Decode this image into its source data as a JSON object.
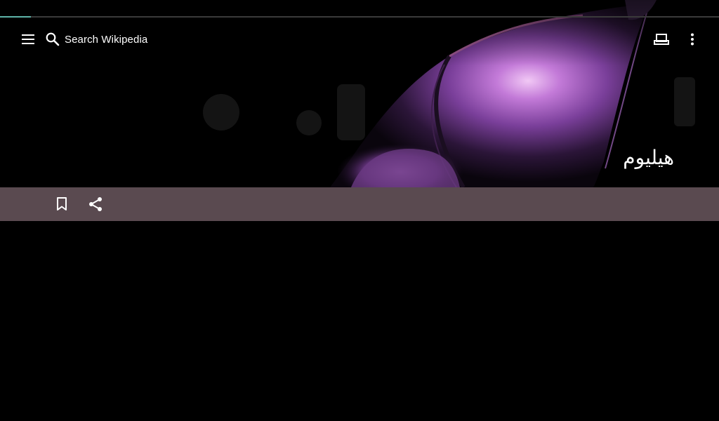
{
  "search": {
    "label": "Search Wikipedia"
  },
  "article": {
    "title": "هيليوم"
  },
  "progress": {
    "fraction": 0.043
  },
  "colors": {
    "background": "#000000",
    "action_bar": "#5a4a50",
    "progress": "#5fb4a8",
    "text": "#ffffff"
  },
  "icons": {
    "menu": "hamburger-menu-icon",
    "search": "search-icon",
    "tabs": "tabs-icon",
    "overflow": "more-vert-icon",
    "bookmark": "bookmark-icon",
    "share": "share-icon"
  }
}
